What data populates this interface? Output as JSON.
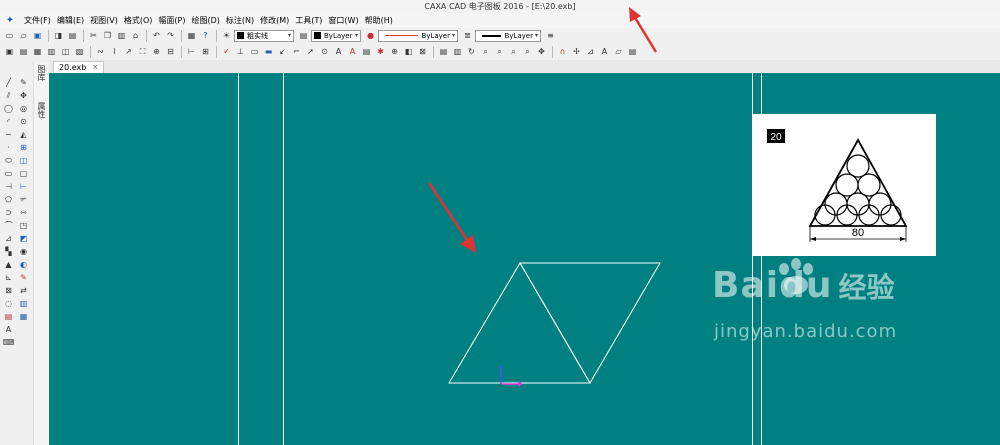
{
  "window": {
    "title": "CAXA CAD 电子图板 2016 - [E:\\20.exb]"
  },
  "menu": [
    "文件(F)",
    "编辑(E)",
    "视图(V)",
    "格式(O)",
    "幅面(P)",
    "绘图(D)",
    "标注(N)",
    "修改(M)",
    "工具(T)",
    "窗口(W)",
    "帮助(H)"
  ],
  "toolbar": {
    "linetype_value": "粗实线",
    "color_value": "ByLayer",
    "linestyle_value": "ByLayer",
    "lineweight_value": "ByLayer"
  },
  "document": {
    "tab_label": "20.exb",
    "close_glyph": "×"
  },
  "side_panel": {
    "tab1": "图库",
    "tab2": "属性"
  },
  "reference": {
    "number_badge": "20",
    "dimension": "80"
  },
  "watermark": {
    "brand": "Baidu",
    "brand_cn": "经验",
    "url": "jingyan.baidu.com"
  },
  "colors": {
    "canvas": "#008080",
    "drawing_line": "#ffffff",
    "annotation_arrow": "#e03434",
    "axis_x": "#d040d0",
    "axis_y": "#5050ff"
  },
  "icons": {
    "standard_toolbar": [
      "new-file-icon",
      "open-file-icon",
      "save-icon",
      "print-icon",
      "cut-icon",
      "copy-icon",
      "paste-icon",
      "undo-icon",
      "redo-icon",
      "help-icon"
    ],
    "left_draw_tools": [
      "line-icon",
      "arc-icon",
      "circle-icon",
      "polyline-icon",
      "move-icon",
      "rotate-icon",
      "mirror-icon",
      "text-icon"
    ]
  }
}
